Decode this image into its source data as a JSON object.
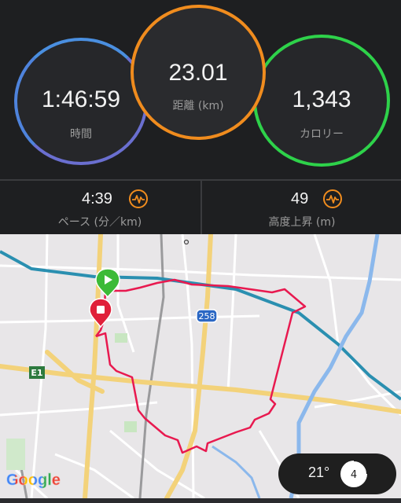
{
  "stats": {
    "time": {
      "value": "1:46:59",
      "label": "時間"
    },
    "distance": {
      "value": "23.01",
      "label": "距離 (km)"
    },
    "calories": {
      "value": "1,343",
      "label": "カロリー"
    }
  },
  "metrics": {
    "pace": {
      "value": "4:39",
      "label": "ペース (分／km)"
    },
    "elevation": {
      "value": "49",
      "label": "高度上昇 (m)"
    }
  },
  "map": {
    "route_shield": "258",
    "expressway_shield": "E1",
    "attribution": "Google",
    "start_marker": "play-marker",
    "end_marker": "stop-marker"
  },
  "weather": {
    "temperature": "21°",
    "wind": "4"
  },
  "colors": {
    "time_ring": "#6a6fd0",
    "distance_ring": "#f08c1e",
    "calories_ring": "#2ed24a",
    "route": "#e8194f",
    "start": "#3cba37",
    "end": "#e0203a"
  }
}
